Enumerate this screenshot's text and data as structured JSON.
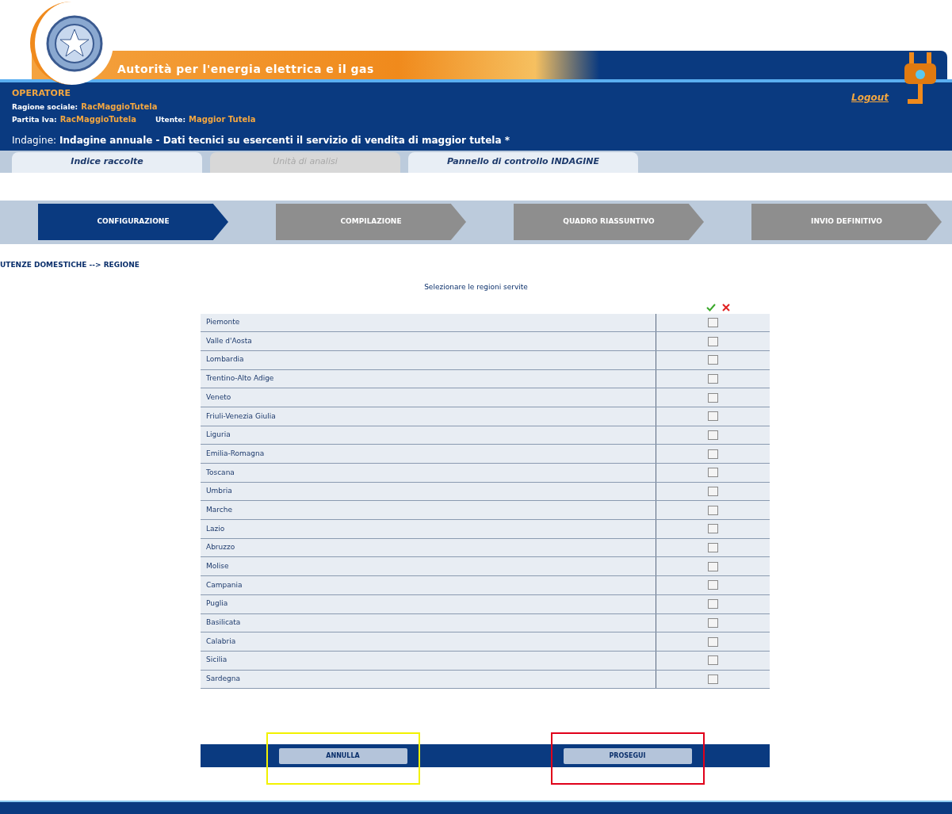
{
  "header": {
    "title": "Autorità per l'energia elettrica e il gas",
    "logout": "Logout"
  },
  "operator": {
    "heading": "OPERATORE",
    "fields": [
      {
        "label": "Ragione sociale:",
        "value": "RacMaggioTutela"
      },
      {
        "label": "Partita Iva:",
        "value": "RacMaggioTutela"
      },
      {
        "label": "Utente:",
        "value": "Maggior Tutela"
      }
    ],
    "survey_label": "Indagine:",
    "survey": "Indagine annuale - Dati tecnici su esercenti il servizio di vendita di maggior tutela *"
  },
  "tabs": [
    {
      "label": "Indice raccolte",
      "disabled": false
    },
    {
      "label": "Unità di analisi",
      "disabled": true
    },
    {
      "label": "Pannello di controllo INDAGINE",
      "disabled": false
    }
  ],
  "steps": [
    {
      "label": "CONFIGURAZIONE",
      "selected": true
    },
    {
      "label": "COMPILAZIONE",
      "selected": false
    },
    {
      "label": "QUADRO RIASSUNTIVO",
      "selected": false
    },
    {
      "label": "INVIO DEFINITIVO",
      "selected": false
    }
  ],
  "breadcrumb": "UTENZE DOMESTICHE --> REGIONE",
  "instruction": "Selezionare le regioni servite",
  "regions": [
    {
      "name": "Piemonte",
      "checked": false
    },
    {
      "name": "Valle d'Aosta",
      "checked": false
    },
    {
      "name": "Lombardia",
      "checked": false
    },
    {
      "name": "Trentino-Alto Adige",
      "checked": false
    },
    {
      "name": "Veneto",
      "checked": false
    },
    {
      "name": "Friuli-Venezia Giulia",
      "checked": false
    },
    {
      "name": "Liguria",
      "checked": false
    },
    {
      "name": "Emilia-Romagna",
      "checked": false
    },
    {
      "name": "Toscana",
      "checked": false
    },
    {
      "name": "Umbria",
      "checked": false
    },
    {
      "name": "Marche",
      "checked": false
    },
    {
      "name": "Lazio",
      "checked": false
    },
    {
      "name": "Abruzzo",
      "checked": false
    },
    {
      "name": "Molise",
      "checked": false
    },
    {
      "name": "Campania",
      "checked": false
    },
    {
      "name": "Puglia",
      "checked": false
    },
    {
      "name": "Basilicata",
      "checked": false
    },
    {
      "name": "Calabria",
      "checked": false
    },
    {
      "name": "Sicilia",
      "checked": false
    },
    {
      "name": "Sardegna",
      "checked": false
    }
  ],
  "buttons": [
    {
      "label": "ANNULLA",
      "color": "#f2f200"
    },
    {
      "label": "PROSEGUI",
      "color": "#e0001a"
    }
  ]
}
